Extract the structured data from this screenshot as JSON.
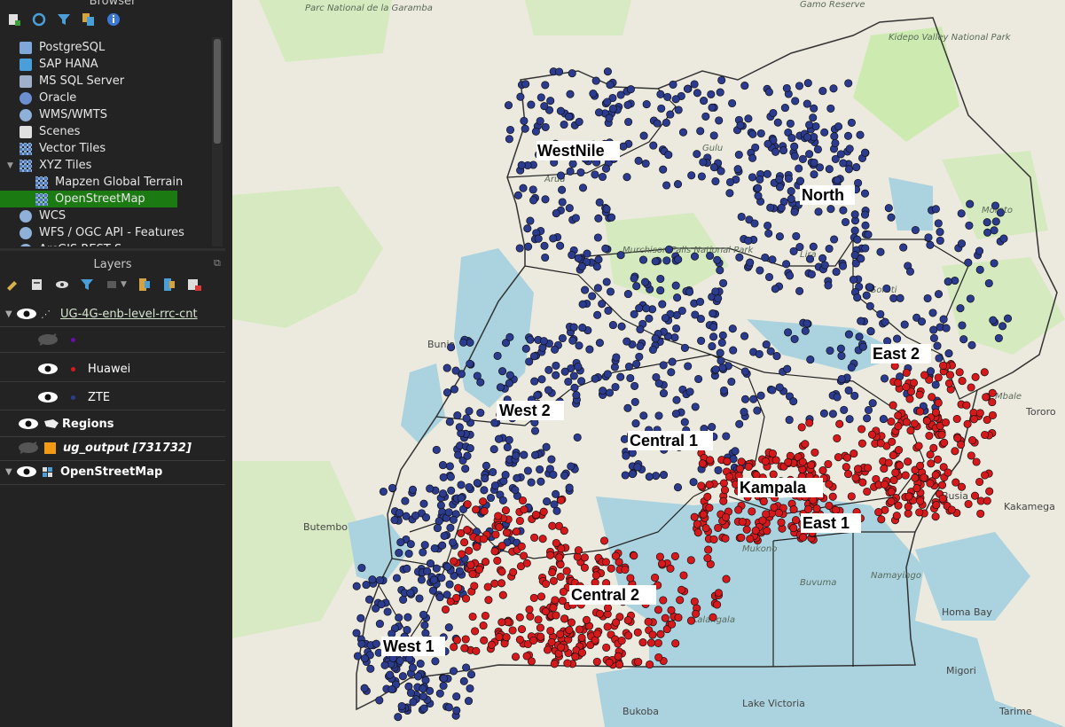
{
  "browser": {
    "title": "Browser",
    "items": [
      {
        "label": "PostgreSQL",
        "icon": "postgresql-icon"
      },
      {
        "label": "SAP HANA",
        "icon": "sap-hana-icon"
      },
      {
        "label": "MS SQL Server",
        "icon": "mssql-icon"
      },
      {
        "label": "Oracle",
        "icon": "oracle-icon"
      },
      {
        "label": "WMS/WMTS",
        "icon": "globe-icon"
      },
      {
        "label": "Scenes",
        "icon": "scenes-icon"
      },
      {
        "label": "Vector Tiles",
        "icon": "grid-icon"
      },
      {
        "label": "XYZ Tiles",
        "icon": "grid-icon"
      },
      {
        "label": "Mapzen Global Terrain",
        "icon": "grid-icon"
      },
      {
        "label": "OpenStreetMap",
        "icon": "grid-icon"
      },
      {
        "label": "WCS",
        "icon": "globe-icon"
      },
      {
        "label": "WFS / OGC API - Features",
        "icon": "globe-icon"
      },
      {
        "label": "ArcGIS REST S...",
        "icon": "globe-icon"
      }
    ]
  },
  "layers": {
    "title": "Layers",
    "items": [
      {
        "label": "UG-4G-enb-level-rrc-cnt",
        "visible": true
      },
      {
        "label": "",
        "visible": false,
        "color": "#6a0dad"
      },
      {
        "label": "Huawei",
        "visible": true,
        "color": "#d7191c"
      },
      {
        "label": "ZTE",
        "visible": true,
        "color": "#2b3b8f"
      },
      {
        "label": "Regions",
        "visible": true
      },
      {
        "label": "ug_output [731732]",
        "visible": false
      },
      {
        "label": "OpenStreetMap",
        "visible": true
      }
    ]
  },
  "map": {
    "regions": [
      "WestNile",
      "North",
      "East 2",
      "West 2",
      "Central 1",
      "Kampala",
      "East 1",
      "Central 2",
      "West 1"
    ],
    "place_names": [
      "Bunia",
      "Butembo",
      "Lake Victoria",
      "Kakamega",
      "Busia",
      "Tororo",
      "Homa Bay",
      "Migori",
      "Tarime",
      "Bukoba",
      "Gamo Reserve",
      "Parc National de la Garamba",
      "Kidepo Valley National Park",
      "Murchison Falls National Park",
      "Buvuma",
      "Namayingo",
      "Kalangala",
      "Mukono",
      "Arua",
      "Moroto",
      "Mbale",
      "Lira",
      "Gulu",
      "Soroti"
    ],
    "colors": {
      "huawei": "#d7191c",
      "zte": "#2b3b8f",
      "water": "#aad3df",
      "park": "#cdebb0"
    }
  }
}
